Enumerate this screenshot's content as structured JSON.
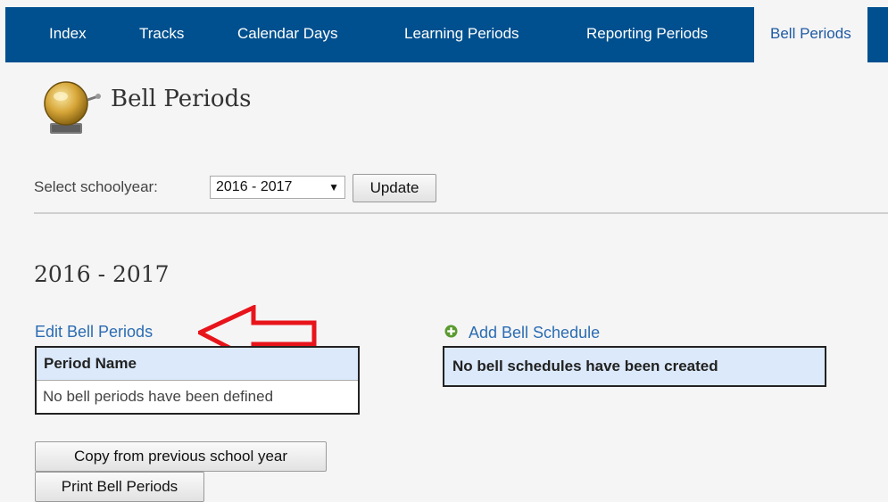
{
  "nav": {
    "tabs": [
      {
        "label": "Index"
      },
      {
        "label": "Tracks"
      },
      {
        "label": "Calendar Days"
      },
      {
        "label": "Learning Periods"
      },
      {
        "label": "Reporting Periods"
      },
      {
        "label": "Bell Periods",
        "active": true
      }
    ],
    "bar_color": "#00508f"
  },
  "page": {
    "title": "Bell Periods",
    "icon": "bell-icon"
  },
  "schoolyear": {
    "label": "Select schoolyear:",
    "selected": "2016 - 2017",
    "update_label": "Update"
  },
  "main": {
    "year_heading": "2016 - 2017",
    "edit_link": "Edit Bell Periods",
    "add_schedule_link": "Add Bell Schedule",
    "periods_table": {
      "header": "Period Name",
      "empty_message": "No bell periods have been defined"
    },
    "schedules_message": "No bell schedules have been created",
    "copy_button": "Copy from previous school year",
    "print_button": "Print Bell Periods"
  },
  "annotation": {
    "arrow_color": "#e8141b",
    "points_to": "edit-bell-periods-link"
  }
}
